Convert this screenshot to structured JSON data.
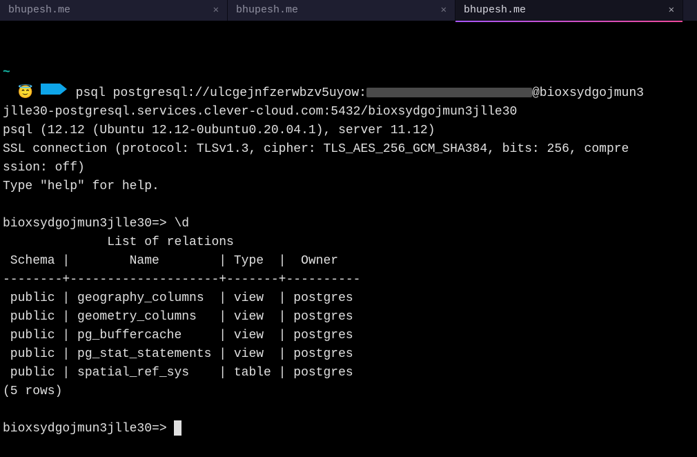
{
  "tabs": [
    {
      "title": "bhupesh.me",
      "active": false
    },
    {
      "title": "bhupesh.me",
      "active": false
    },
    {
      "title": "bhupesh.me",
      "active": true
    }
  ],
  "prompt": {
    "emoji": "😇",
    "tilde": "~"
  },
  "cmd": {
    "psql_prefix": "psql postgresql://ulcgejnfzerwbzv5uyow:",
    "psql_suffix_host": "@bioxsydgojmun3",
    "conn_line2": "jlle30-postgresql.services.clever-cloud.com:5432/bioxsydgojmun3jlle30"
  },
  "banner": {
    "version": "psql (12.12 (Ubuntu 12.12-0ubuntu0.20.04.1), server 11.12)",
    "ssl1": "SSL connection (protocol: TLSv1.3, cipher: TLS_AES_256_GCM_SHA384, bits: 256, compre",
    "ssl2": "ssion: off)",
    "help": "Type \"help\" for help."
  },
  "dbprompt": {
    "name": "bioxsydgojmun3jlle30=>",
    "cmd": " \\d"
  },
  "table": {
    "title": "              List of relations",
    "header": " Schema |        Name        | Type  |  Owner   ",
    "divider": "--------+--------------------+-------+----------",
    "rows": [
      " public | geography_columns  | view  | postgres",
      " public | geometry_columns   | view  | postgres",
      " public | pg_buffercache     | view  | postgres",
      " public | pg_stat_statements | view  | postgres",
      " public | spatial_ref_sys    | table | postgres"
    ],
    "footer": "(5 rows)"
  }
}
